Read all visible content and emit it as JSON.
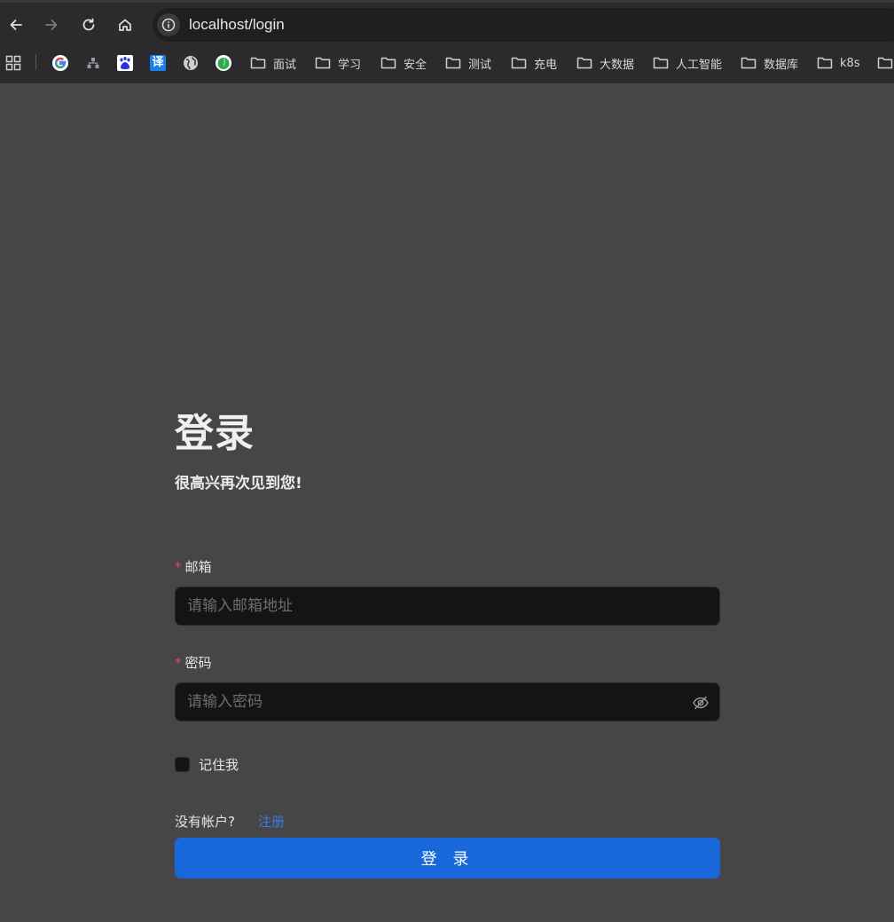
{
  "browser": {
    "url": "localhost/login",
    "bookmarks": [
      {
        "label": "",
        "icon": "google-icon"
      },
      {
        "label": "",
        "icon": "network-icon"
      },
      {
        "label": "",
        "icon": "baidu-icon"
      },
      {
        "label": "译",
        "icon": "translate-icon"
      },
      {
        "label": "",
        "icon": "globe-icon"
      },
      {
        "label": "",
        "icon": "green-leaf-icon"
      },
      {
        "label": "面试",
        "icon": "folder-icon"
      },
      {
        "label": "学习",
        "icon": "folder-icon"
      },
      {
        "label": "安全",
        "icon": "folder-icon"
      },
      {
        "label": "测试",
        "icon": "folder-icon"
      },
      {
        "label": "充电",
        "icon": "folder-icon"
      },
      {
        "label": "大数据",
        "icon": "folder-icon"
      },
      {
        "label": "人工智能",
        "icon": "folder-icon"
      },
      {
        "label": "数据库",
        "icon": "folder-icon"
      },
      {
        "label": "k8s",
        "icon": "folder-icon"
      },
      {
        "label": "",
        "icon": "folder-icon"
      }
    ]
  },
  "login": {
    "title": "登录",
    "subtitle": "很高兴再次见到您!",
    "email": {
      "required_mark": "*",
      "label": "邮箱",
      "value": "",
      "placeholder": "请输入邮箱地址"
    },
    "password": {
      "required_mark": "*",
      "label": "密码",
      "value": "",
      "placeholder": "请输入密码"
    },
    "remember_label": "记住我",
    "no_account_text": "没有帐户?",
    "signup_link": "注册",
    "submit_label": "登 录"
  },
  "colors": {
    "page_bg": "#464548",
    "input_bg": "#141414",
    "primary": "#1868db",
    "link": "#3b7ddd",
    "required": "#e0505b"
  }
}
